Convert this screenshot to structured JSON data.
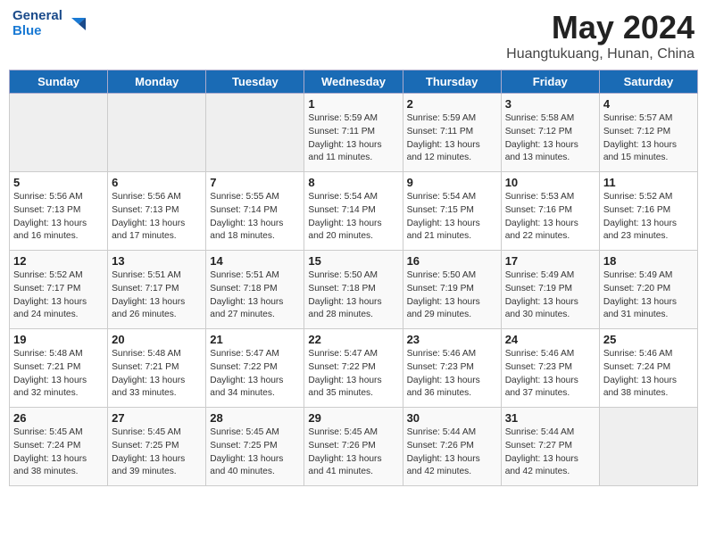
{
  "header": {
    "logo_line1": "General",
    "logo_line2": "Blue",
    "title": "May 2024",
    "subtitle": "Huangtukuang, Hunan, China"
  },
  "days_of_week": [
    "Sunday",
    "Monday",
    "Tuesday",
    "Wednesday",
    "Thursday",
    "Friday",
    "Saturday"
  ],
  "weeks": [
    [
      {
        "day": "",
        "info": ""
      },
      {
        "day": "",
        "info": ""
      },
      {
        "day": "",
        "info": ""
      },
      {
        "day": "1",
        "info": "Sunrise: 5:59 AM\nSunset: 7:11 PM\nDaylight: 13 hours\nand 11 minutes."
      },
      {
        "day": "2",
        "info": "Sunrise: 5:59 AM\nSunset: 7:11 PM\nDaylight: 13 hours\nand 12 minutes."
      },
      {
        "day": "3",
        "info": "Sunrise: 5:58 AM\nSunset: 7:12 PM\nDaylight: 13 hours\nand 13 minutes."
      },
      {
        "day": "4",
        "info": "Sunrise: 5:57 AM\nSunset: 7:12 PM\nDaylight: 13 hours\nand 15 minutes."
      }
    ],
    [
      {
        "day": "5",
        "info": "Sunrise: 5:56 AM\nSunset: 7:13 PM\nDaylight: 13 hours\nand 16 minutes."
      },
      {
        "day": "6",
        "info": "Sunrise: 5:56 AM\nSunset: 7:13 PM\nDaylight: 13 hours\nand 17 minutes."
      },
      {
        "day": "7",
        "info": "Sunrise: 5:55 AM\nSunset: 7:14 PM\nDaylight: 13 hours\nand 18 minutes."
      },
      {
        "day": "8",
        "info": "Sunrise: 5:54 AM\nSunset: 7:14 PM\nDaylight: 13 hours\nand 20 minutes."
      },
      {
        "day": "9",
        "info": "Sunrise: 5:54 AM\nSunset: 7:15 PM\nDaylight: 13 hours\nand 21 minutes."
      },
      {
        "day": "10",
        "info": "Sunrise: 5:53 AM\nSunset: 7:16 PM\nDaylight: 13 hours\nand 22 minutes."
      },
      {
        "day": "11",
        "info": "Sunrise: 5:52 AM\nSunset: 7:16 PM\nDaylight: 13 hours\nand 23 minutes."
      }
    ],
    [
      {
        "day": "12",
        "info": "Sunrise: 5:52 AM\nSunset: 7:17 PM\nDaylight: 13 hours\nand 24 minutes."
      },
      {
        "day": "13",
        "info": "Sunrise: 5:51 AM\nSunset: 7:17 PM\nDaylight: 13 hours\nand 26 minutes."
      },
      {
        "day": "14",
        "info": "Sunrise: 5:51 AM\nSunset: 7:18 PM\nDaylight: 13 hours\nand 27 minutes."
      },
      {
        "day": "15",
        "info": "Sunrise: 5:50 AM\nSunset: 7:18 PM\nDaylight: 13 hours\nand 28 minutes."
      },
      {
        "day": "16",
        "info": "Sunrise: 5:50 AM\nSunset: 7:19 PM\nDaylight: 13 hours\nand 29 minutes."
      },
      {
        "day": "17",
        "info": "Sunrise: 5:49 AM\nSunset: 7:19 PM\nDaylight: 13 hours\nand 30 minutes."
      },
      {
        "day": "18",
        "info": "Sunrise: 5:49 AM\nSunset: 7:20 PM\nDaylight: 13 hours\nand 31 minutes."
      }
    ],
    [
      {
        "day": "19",
        "info": "Sunrise: 5:48 AM\nSunset: 7:21 PM\nDaylight: 13 hours\nand 32 minutes."
      },
      {
        "day": "20",
        "info": "Sunrise: 5:48 AM\nSunset: 7:21 PM\nDaylight: 13 hours\nand 33 minutes."
      },
      {
        "day": "21",
        "info": "Sunrise: 5:47 AM\nSunset: 7:22 PM\nDaylight: 13 hours\nand 34 minutes."
      },
      {
        "day": "22",
        "info": "Sunrise: 5:47 AM\nSunset: 7:22 PM\nDaylight: 13 hours\nand 35 minutes."
      },
      {
        "day": "23",
        "info": "Sunrise: 5:46 AM\nSunset: 7:23 PM\nDaylight: 13 hours\nand 36 minutes."
      },
      {
        "day": "24",
        "info": "Sunrise: 5:46 AM\nSunset: 7:23 PM\nDaylight: 13 hours\nand 37 minutes."
      },
      {
        "day": "25",
        "info": "Sunrise: 5:46 AM\nSunset: 7:24 PM\nDaylight: 13 hours\nand 38 minutes."
      }
    ],
    [
      {
        "day": "26",
        "info": "Sunrise: 5:45 AM\nSunset: 7:24 PM\nDaylight: 13 hours\nand 38 minutes."
      },
      {
        "day": "27",
        "info": "Sunrise: 5:45 AM\nSunset: 7:25 PM\nDaylight: 13 hours\nand 39 minutes."
      },
      {
        "day": "28",
        "info": "Sunrise: 5:45 AM\nSunset: 7:25 PM\nDaylight: 13 hours\nand 40 minutes."
      },
      {
        "day": "29",
        "info": "Sunrise: 5:45 AM\nSunset: 7:26 PM\nDaylight: 13 hours\nand 41 minutes."
      },
      {
        "day": "30",
        "info": "Sunrise: 5:44 AM\nSunset: 7:26 PM\nDaylight: 13 hours\nand 42 minutes."
      },
      {
        "day": "31",
        "info": "Sunrise: 5:44 AM\nSunset: 7:27 PM\nDaylight: 13 hours\nand 42 minutes."
      },
      {
        "day": "",
        "info": ""
      }
    ]
  ]
}
